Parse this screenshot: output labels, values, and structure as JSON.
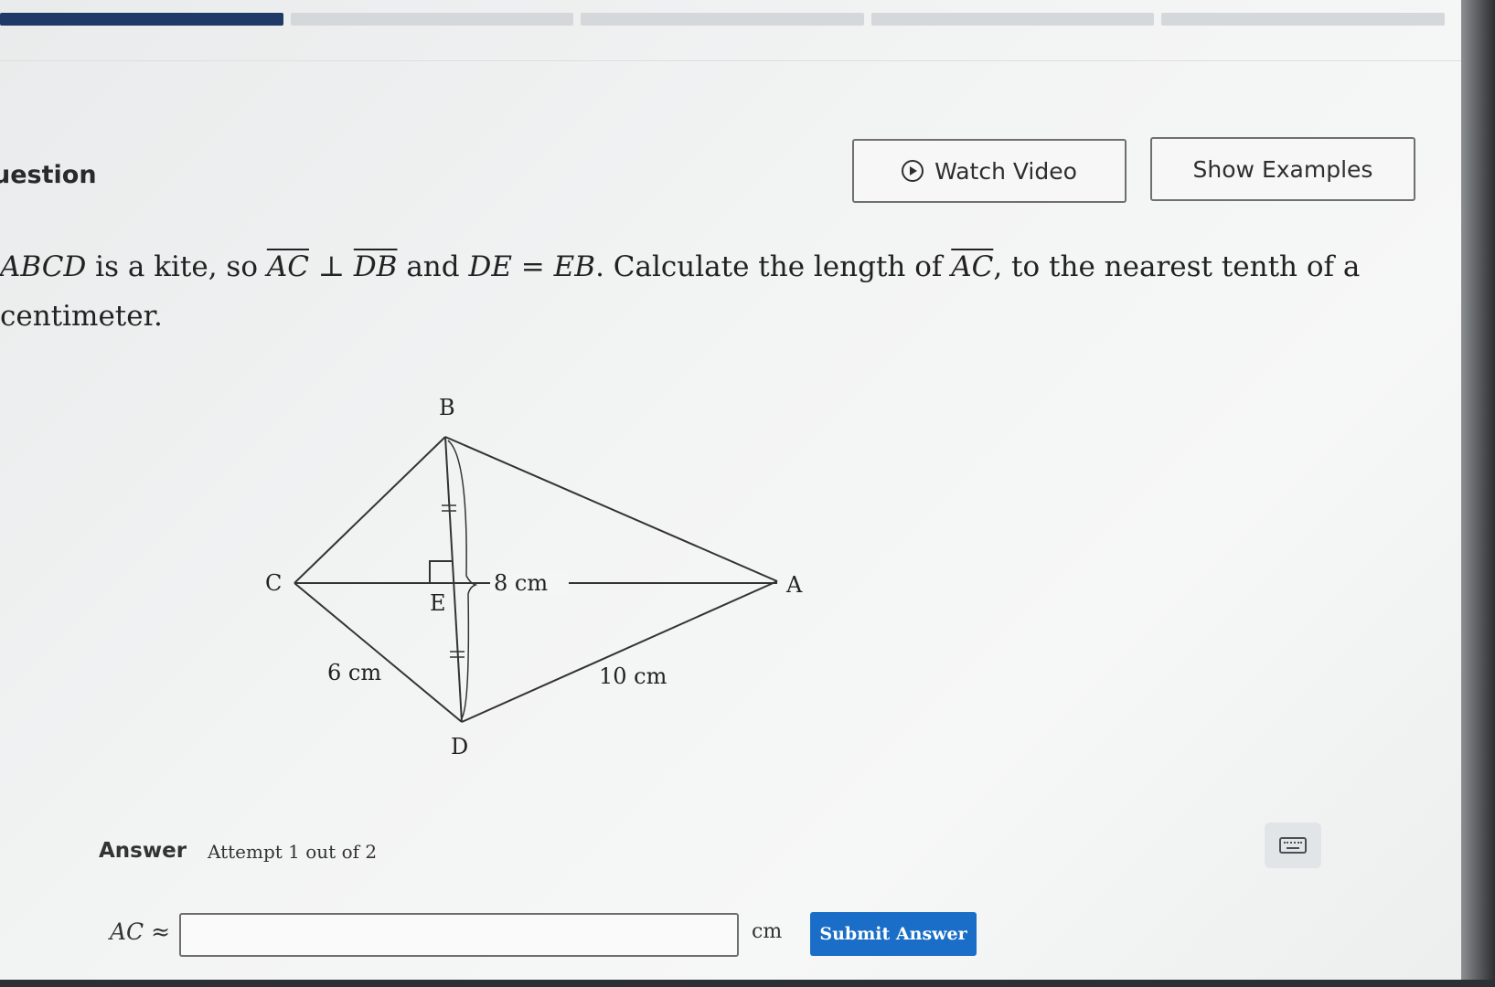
{
  "progress": {
    "segments": 5,
    "completed": 1
  },
  "header": {
    "question_label": "uestion",
    "watch_video_label": "Watch Video",
    "show_examples_label": "Show Examples"
  },
  "problem": {
    "kite": "ABCD",
    "t1": " is a kite, so ",
    "ac1": "AC",
    "perp": " ⊥ ",
    "db": "DB",
    "t2": " and ",
    "de": "DE",
    "eq": " = ",
    "eb": "EB",
    "t3": ". Calculate the length of ",
    "ac2": "AC",
    "t4": ", to the nearest tenth of a centimeter."
  },
  "figure": {
    "labels": {
      "A": "A",
      "B": "B",
      "C": "C",
      "D": "D",
      "E": "E"
    },
    "measurements": {
      "EA": "8 cm",
      "CD": "6 cm",
      "DA": "10 cm"
    }
  },
  "answer": {
    "label": "Answer",
    "attempt": "Attempt 1 out of 2",
    "ac_label": "AC ≈",
    "input_value": "",
    "unit": "cm",
    "submit_label": "Submit Answer"
  },
  "icons": {
    "play": "play-circle-icon",
    "keyboard": "keyboard-icon"
  },
  "colors": {
    "progress_done": "#1f3a66",
    "submit_bg": "#1a6ec7"
  }
}
